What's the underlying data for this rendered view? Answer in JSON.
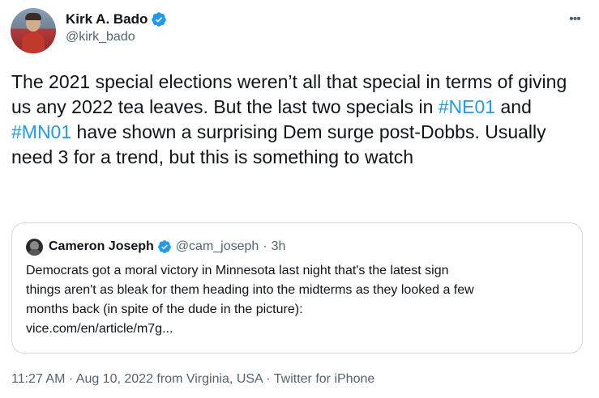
{
  "author": {
    "name": "Kirk A. Bado",
    "handle": "@kirk_bado"
  },
  "more_label": "•••",
  "tweet": {
    "segments": [
      "The 2021 special elections weren’t all that special in terms of giving us any 2022 tea leaves. But the last two specials in ",
      "#NE01",
      " and ",
      "#MN01",
      " have shown a surprising Dem surge post-Dobbs. Usually need 3 for a trend, but this is something to watch"
    ]
  },
  "quoted": {
    "name": "Cameron Joseph",
    "handle": "@cam_joseph",
    "separator": "·",
    "time": "3h",
    "lines": [
      "Democrats got a moral victory in Minnesota last night that's the latest sign",
      "things aren't as bleak for them heading into the midterms as they looked a few",
      "months back (in spite of the dude in the picture):",
      "vice.com/en/article/m7g..."
    ]
  },
  "meta": {
    "time": "11:27 AM",
    "sep1": "·",
    "date_location": "Aug 10, 2022 from Virginia, USA",
    "sep2": "·",
    "source": "Twitter for iPhone"
  },
  "colors": {
    "accent": "#1d9bf0",
    "secondary_text": "#536471",
    "border": "#cfd9de"
  },
  "icons": {
    "verified": "verified-badge-icon",
    "more": "more-options-icon"
  }
}
